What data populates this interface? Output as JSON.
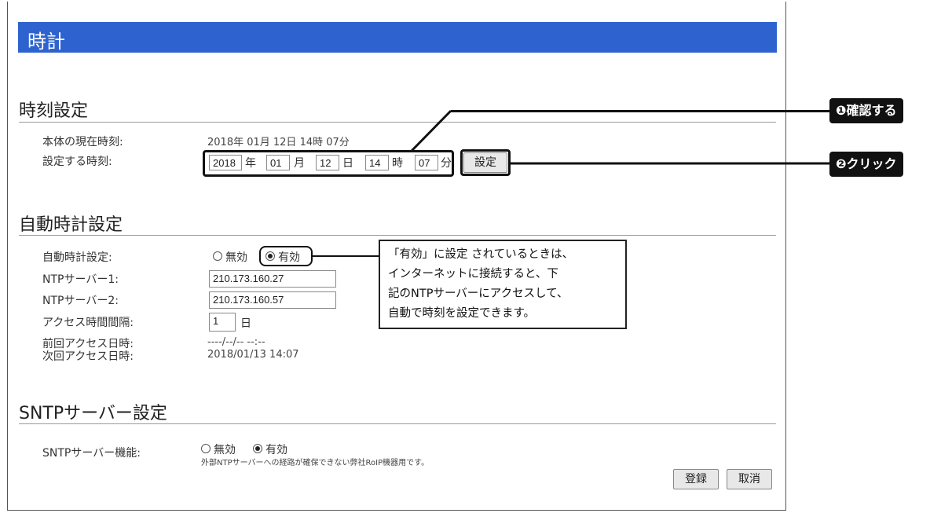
{
  "header": {
    "title": "時計"
  },
  "time_section": {
    "title": "時刻設定",
    "current_label": "本体の現在時刻:",
    "current_value": "2018年 01月 12日 14時 07分",
    "set_label": "設定する時刻:",
    "year": "2018",
    "year_unit": "年",
    "month": "01",
    "month_unit": "月",
    "day": "12",
    "day_unit": "日",
    "hour": "14",
    "hour_unit": "時",
    "minute": "07",
    "minute_unit": "分",
    "set_button": "設定"
  },
  "auto_section": {
    "title": "自動時計設定",
    "auto_label": "自動時計設定:",
    "option_disabled": "無効",
    "option_enabled": "有効",
    "selected": "有効",
    "ntp1_label": "NTPサーバー1:",
    "ntp1_value": "210.173.160.27",
    "ntp2_label": "NTPサーバー2:",
    "ntp2_value": "210.173.160.57",
    "interval_label": "アクセス時間間隔:",
    "interval_value": "1",
    "interval_unit": "日",
    "last_access_label": "前回アクセス日時:",
    "last_access_value": "----/--/-- --:--",
    "next_access_label": "次回アクセス日時:",
    "next_access_value": "2018/01/13 14:07"
  },
  "sntp_section": {
    "title": "SNTPサーバー設定",
    "function_label": "SNTPサーバー機能:",
    "option_disabled": "無効",
    "option_enabled": "有効",
    "selected": "有効",
    "note": "外部NTPサーバーへの経路が確保できない弊社RoIP機器用です。"
  },
  "footer": {
    "register_button": "登録",
    "cancel_button": "取消"
  },
  "annotations": {
    "step1": "❶確認する",
    "step2": "❷クリック",
    "note_lines": [
      "「有効」に設定 されているときは、",
      "インターネットに接続すると、下",
      "記のNTPサーバーにアクセスして、",
      "自動で時刻を設定できます。"
    ]
  }
}
